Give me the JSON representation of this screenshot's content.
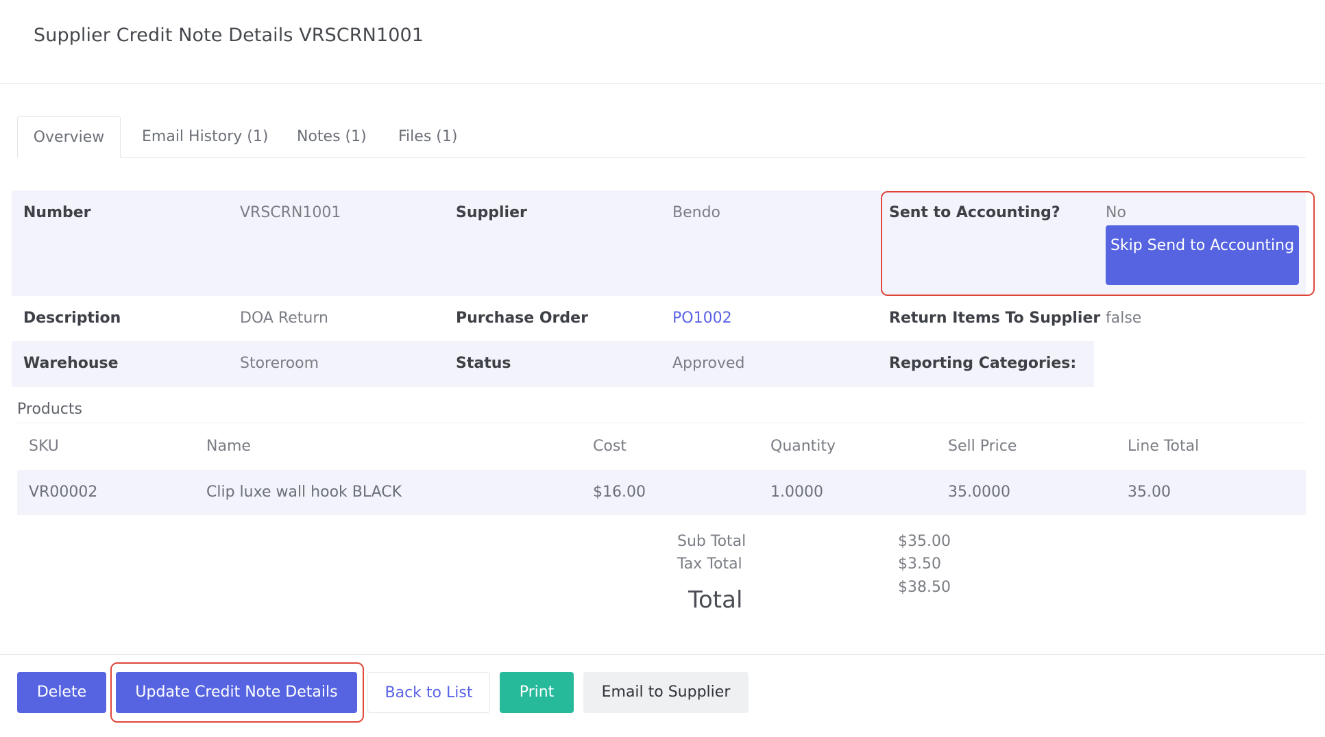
{
  "header": {
    "title": "Supplier Credit Note Details VRSCRN1001"
  },
  "tabs": [
    {
      "label": "Overview",
      "active": true
    },
    {
      "label": "Email History (1)"
    },
    {
      "label": "Notes (1)"
    },
    {
      "label": "Files (1)"
    }
  ],
  "details": {
    "number_label": "Number",
    "number_value": "VRSCRN1001",
    "supplier_label": "Supplier",
    "supplier_value": "Bendo",
    "sent_label": "Sent to Accounting?",
    "sent_value": "No",
    "skip_button": "Skip Send to Accounting",
    "description_label": "Description",
    "description_value": "DOA Return",
    "po_label": "Purchase Order",
    "po_value": "PO1002",
    "return_label": "Return Items To Supplier",
    "return_value": "false",
    "warehouse_label": "Warehouse",
    "warehouse_value": "Storeroom",
    "status_label": "Status",
    "status_value": "Approved",
    "reporting_label": "Reporting Categories:"
  },
  "products": {
    "label": "Products",
    "columns": [
      "SKU",
      "Name",
      "Cost",
      "Quantity",
      "Sell Price",
      "Line Total"
    ],
    "rows": [
      {
        "sku": "VR00002",
        "name": "Clip luxe wall hook BLACK",
        "cost": "$16.00",
        "quantity": "1.0000",
        "sell_price": "35.0000",
        "line_total": "35.00"
      }
    ]
  },
  "totals": {
    "sub_total_label": "Sub Total",
    "sub_total_value": "$35.00",
    "tax_total_label": "Tax Total",
    "tax_total_value": "$3.50",
    "total_label": "Total",
    "total_value": "$38.50"
  },
  "actions": {
    "delete": "Delete",
    "update": "Update Credit Note Details",
    "back": "Back to List",
    "print": "Print",
    "email": "Email to Supplier"
  },
  "colors": {
    "primary": "#5664e1",
    "success": "#26b99a",
    "highlight": "#e0453a",
    "row_shade": "#f3f4fb"
  }
}
